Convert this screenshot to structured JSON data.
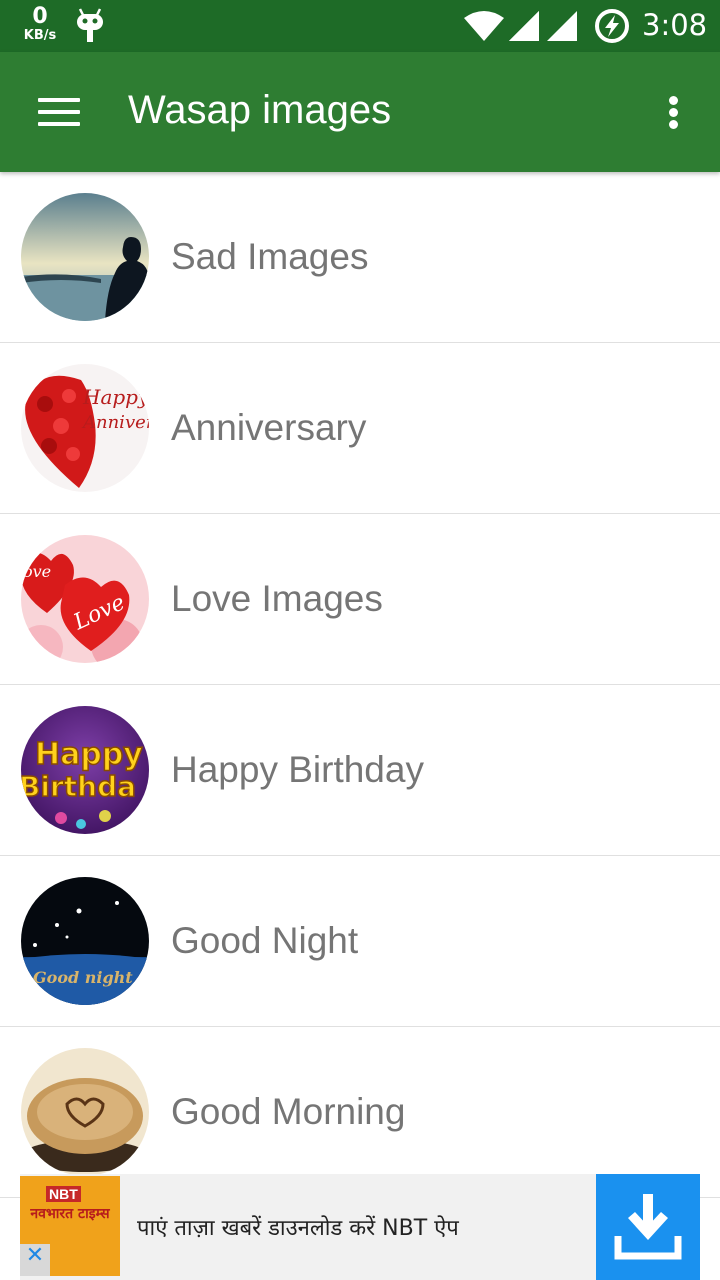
{
  "status_bar": {
    "net_speed": "0",
    "net_unit": "KB/s",
    "time": "3:08"
  },
  "app_bar": {
    "title": "Wasap images"
  },
  "categories": [
    {
      "label": "Sad Images",
      "icon": "sad-image-thumbnail"
    },
    {
      "label": "Anniversary",
      "icon": "anniversary-thumbnail",
      "thumb_text": "Happy Anniver"
    },
    {
      "label": "Love Images",
      "icon": "love-thumbnail",
      "thumb_text": "Love"
    },
    {
      "label": "Happy Birthday",
      "icon": "birthday-thumbnail",
      "thumb_text": "Happy Birthday"
    },
    {
      "label": "Good Night",
      "icon": "good-night-thumbnail",
      "thumb_text": "Good night"
    },
    {
      "label": "Good Morning",
      "icon": "good-morning-thumbnail"
    }
  ],
  "ad": {
    "logo_badge": "NBT",
    "logo_brand": "नवभारत टाइम्स",
    "text": "पाएं ताज़ा खबरें डाउनलोड करें NBT ऐप",
    "close_symbol": "✕"
  },
  "colors": {
    "status_bar": "#1e6b27",
    "app_bar": "#2e7d32",
    "label_text": "#757575",
    "download_button": "#1a91ef"
  }
}
